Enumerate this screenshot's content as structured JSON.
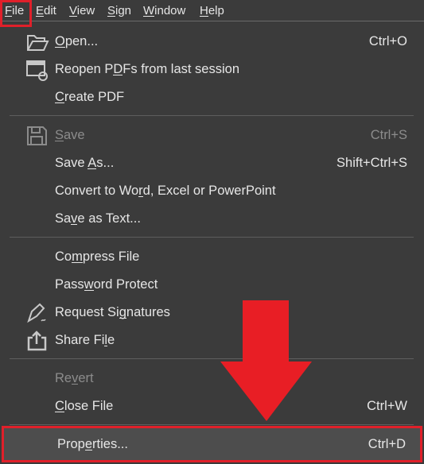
{
  "menubar": [
    {
      "label": "File",
      "mn": 0
    },
    {
      "label": "Edit",
      "mn": 0
    },
    {
      "label": "View",
      "mn": 0
    },
    {
      "label": "Sign",
      "mn": 0
    },
    {
      "label": "Window",
      "mn": 0
    },
    {
      "label": "Help",
      "mn": 0
    }
  ],
  "menu": [
    {
      "label": "Open...",
      "mn": 0,
      "shortcut": "Ctrl+O",
      "icon": "folder-open-icon"
    },
    {
      "label": "Reopen PDFs from last session",
      "mn": 8,
      "shortcut": "",
      "icon": "reopen-session-icon"
    },
    {
      "label": "Create PDF",
      "mn": 0,
      "shortcut": ""
    },
    {
      "label": "Save",
      "mn": 0,
      "shortcut": "Ctrl+S",
      "icon": "save-icon",
      "disabled": true
    },
    {
      "label": "Save As...",
      "mn": 5,
      "shortcut": "Shift+Ctrl+S"
    },
    {
      "label": "Convert to Word, Excel or PowerPoint",
      "mn": 13,
      "shortcut": ""
    },
    {
      "label": "Save as Text...",
      "mn": 2,
      "shortcut": ""
    },
    {
      "label": "Compress File",
      "mn": 2,
      "shortcut": ""
    },
    {
      "label": "Password Protect",
      "mn": 4,
      "shortcut": ""
    },
    {
      "label": "Request Signatures",
      "mn": 10,
      "shortcut": "",
      "icon": "signature-pen-icon"
    },
    {
      "label": "Share File",
      "mn": 8,
      "shortcut": "",
      "icon": "share-icon"
    },
    {
      "label": "Revert",
      "mn": 2,
      "shortcut": "",
      "disabled": true
    },
    {
      "label": "Close File",
      "mn": 0,
      "shortcut": "Ctrl+W"
    },
    {
      "label": "Properties...",
      "mn": 4,
      "shortcut": "Ctrl+D",
      "highlighted": true
    }
  ],
  "colors": {
    "annotation": "#e0202a",
    "background": "#3b3b3b"
  }
}
